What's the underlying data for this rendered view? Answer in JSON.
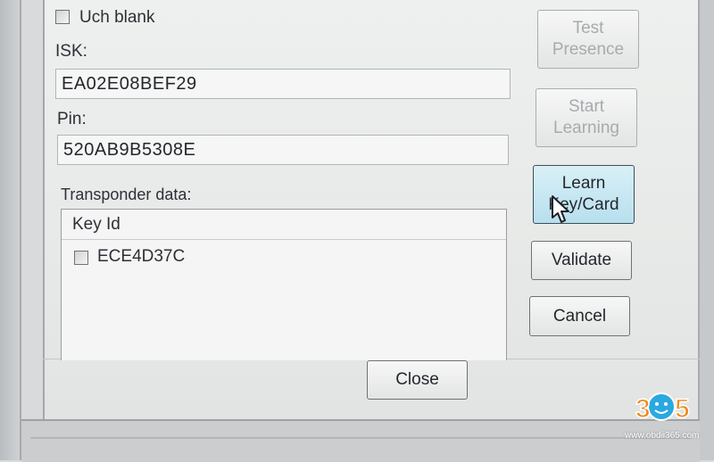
{
  "uch_blank": {
    "label": "Uch blank",
    "checked": false
  },
  "isk": {
    "label": "ISK:",
    "value": "EA02E08BEF29"
  },
  "pin": {
    "label": "Pin:",
    "value": "520AB9B5308E"
  },
  "transponder": {
    "label": "Transponder data:",
    "column_header": "Key Id",
    "rows": [
      {
        "key_id": "ECE4D37C",
        "checked": false
      }
    ]
  },
  "buttons": {
    "test_presence": {
      "line1": "Test",
      "line2": "Presence",
      "enabled": false
    },
    "start_learning": {
      "line1": "Start",
      "line2": "Learning",
      "enabled": false
    },
    "learn_key_card": {
      "line1": "Learn",
      "line2": "Key/Card",
      "enabled": true
    },
    "validate": {
      "label": "Validate"
    },
    "cancel": {
      "label": "Cancel"
    },
    "close": {
      "label": "Close"
    }
  },
  "watermark": {
    "logo_text": "365",
    "url": "www.obdii365.com",
    "colors": {
      "digits": "#f08a1c",
      "face": "#2aa9e0"
    }
  },
  "colors": {
    "dialog_bg": "#eceeed",
    "focused_button": "#c4e6f2",
    "disabled_text": "#a7aaae"
  }
}
